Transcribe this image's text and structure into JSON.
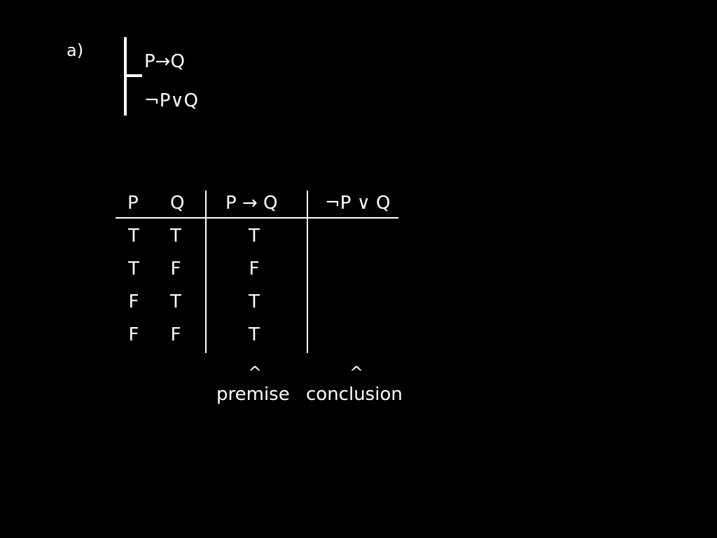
{
  "problem_label": "a)",
  "argument": {
    "premise": "P→Q",
    "conclusion": "¬P∨Q"
  },
  "truth_table": {
    "headers": [
      "P",
      "Q",
      "P → Q",
      "¬P ∨ Q"
    ],
    "rows": [
      [
        "T",
        "T",
        "T",
        ""
      ],
      [
        "T",
        "F",
        "F",
        ""
      ],
      [
        "F",
        "T",
        "T",
        ""
      ],
      [
        "F",
        "F",
        "T",
        ""
      ]
    ]
  },
  "annotations": {
    "premise_caret": "^",
    "premise_label": "premise",
    "conclusion_caret": "^",
    "conclusion_label": "conclusion"
  },
  "colors": {
    "background": "#000000",
    "foreground": "#ffffff"
  }
}
